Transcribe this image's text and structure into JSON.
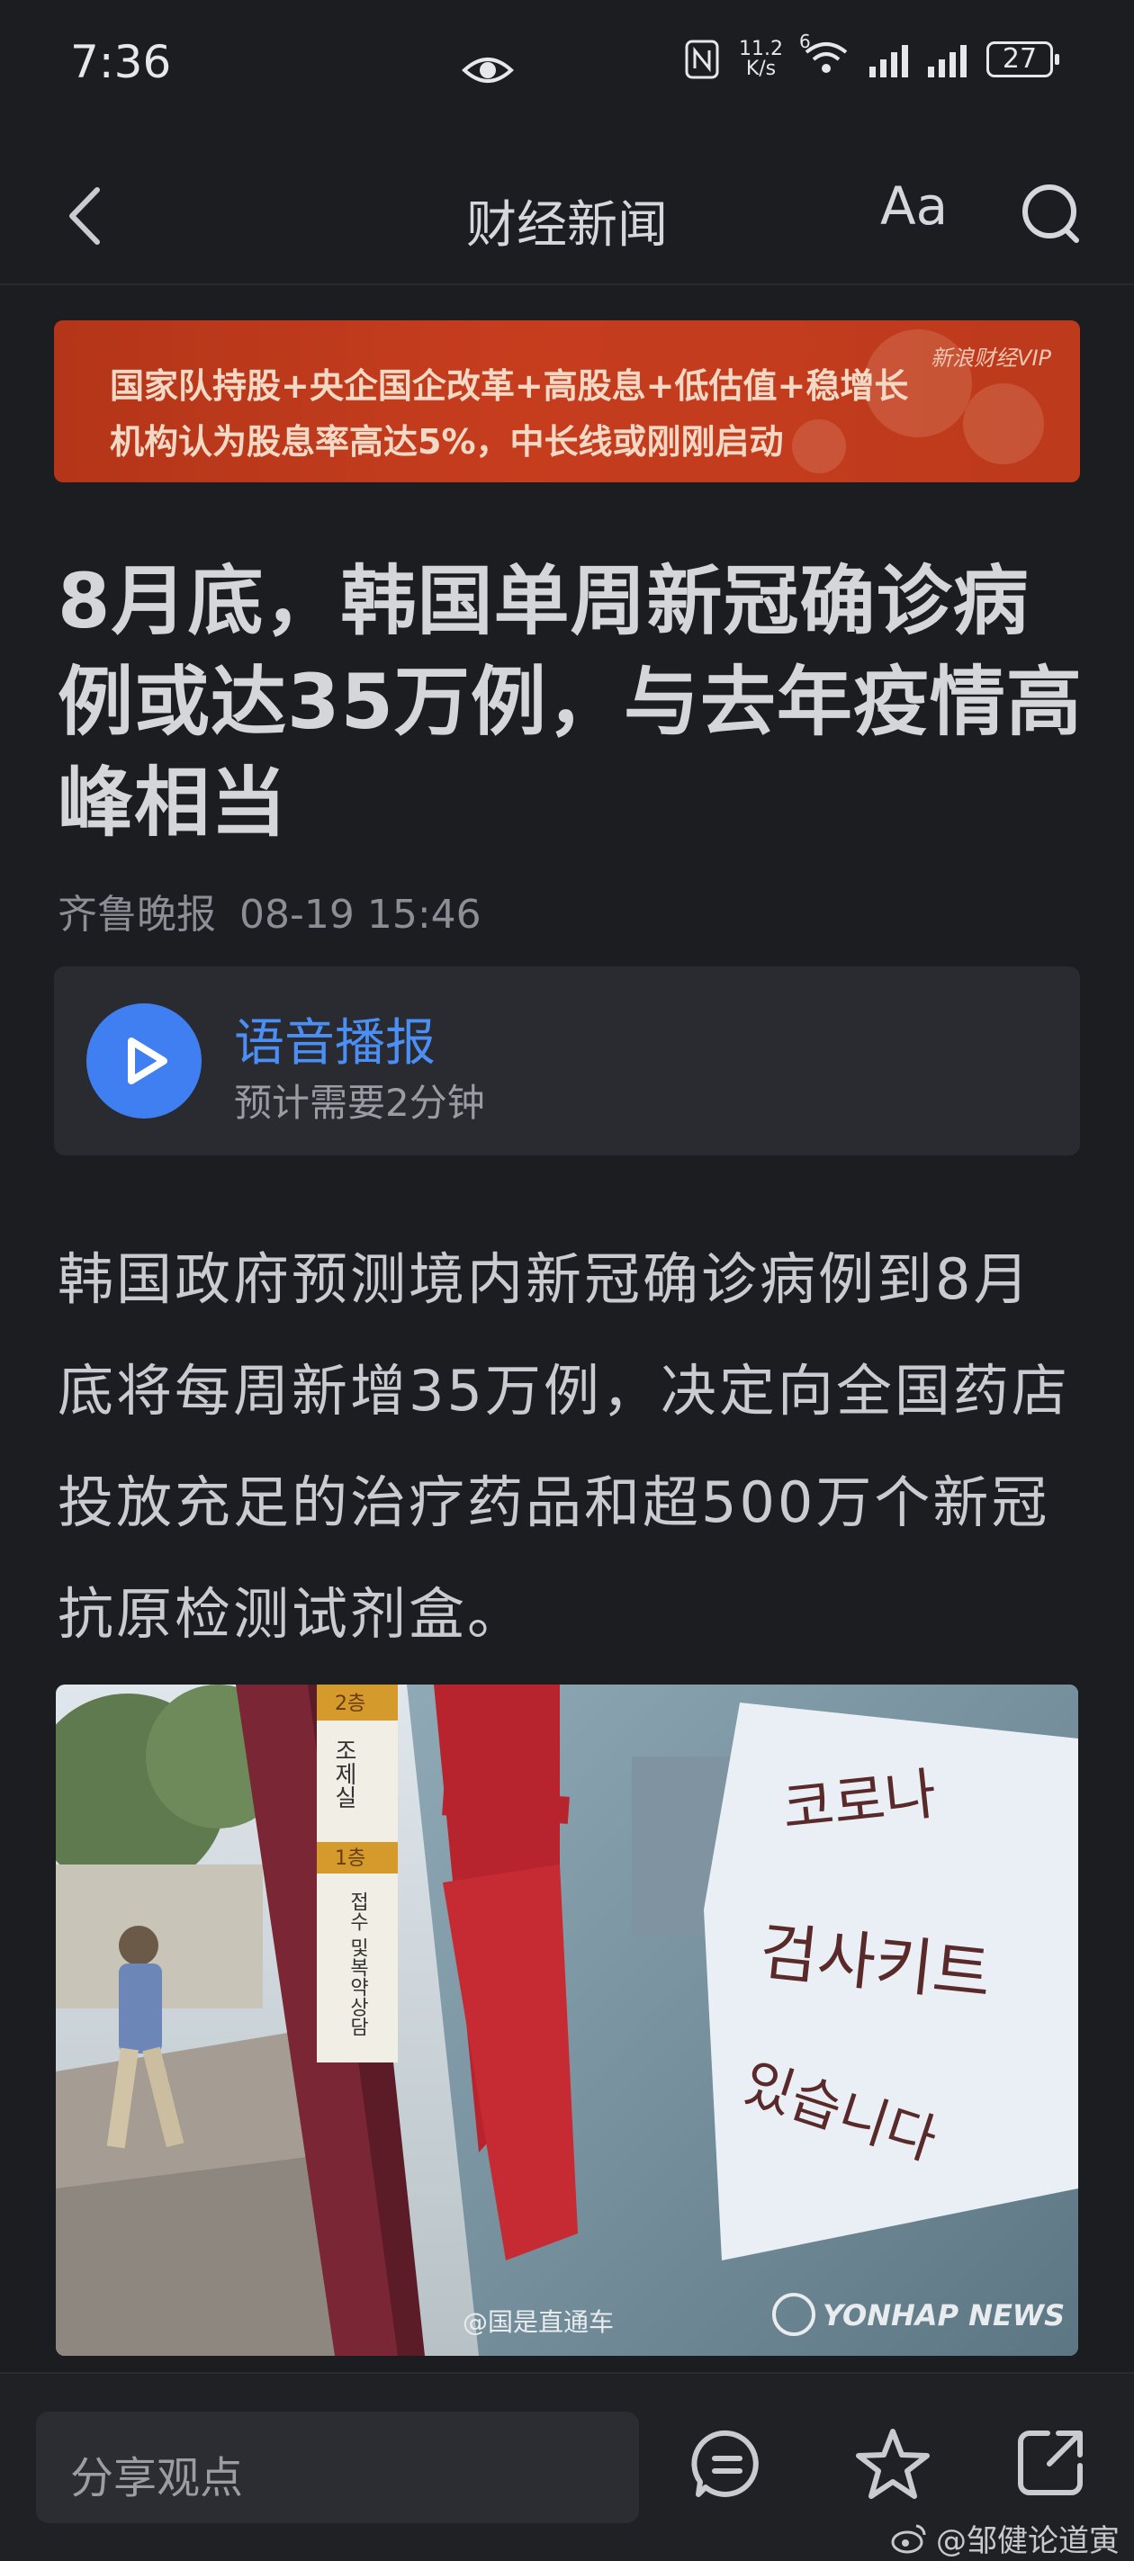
{
  "status_bar": {
    "time": "7:36",
    "net_speed_value": "11.2",
    "net_speed_unit": "K/s",
    "wifi_tag": "6",
    "battery": "27"
  },
  "nav": {
    "title": "财经新闻",
    "font_label": "Aa"
  },
  "banner": {
    "line1": "国家队持股+央企国企改革+高股息+低估值+稳增长",
    "line2": "机构认为股息率高达5%，中长线或刚刚启动",
    "brand": "新浪财经VIP"
  },
  "article": {
    "headline": "8月底，韩国单周新冠确诊病例或达35万例，与去年疫情高峰相当",
    "source": "齐鲁晚报",
    "datetime": "08-19 15:46",
    "audio_title": "语音播报",
    "audio_sub": "预计需要2分钟",
    "body": "韩国政府预测境内新冠确诊病例到8月底将每周新增35万例，决定向全国药店投放充足的治疗药品和超500万个新冠抗原检测试剂盒。",
    "photo": {
      "sign_line1": "코로나",
      "sign_line2": "검사키트",
      "sign_line3": "있습니다",
      "store_label1": "조제실",
      "store_label2": "접수 및복약상담",
      "floor1": "2층",
      "floor2": "1층",
      "agency": "YONHAP NEWS",
      "credit": "@国是直通车"
    }
  },
  "bottom_bar": {
    "share_placeholder": "分享观点"
  },
  "watermark": "@邹健论道寅",
  "colors": {
    "background": "#1c1d21",
    "accent_blue": "#3f7ff1",
    "banner_red": "#c63d1e"
  },
  "icons": [
    "back-icon",
    "font-size-icon",
    "search-icon",
    "play-icon",
    "comment-icon",
    "star-icon",
    "share-icon",
    "eye-icon",
    "nfc-icon",
    "wifi-icon",
    "signal-icon",
    "battery-icon",
    "weibo-icon"
  ]
}
